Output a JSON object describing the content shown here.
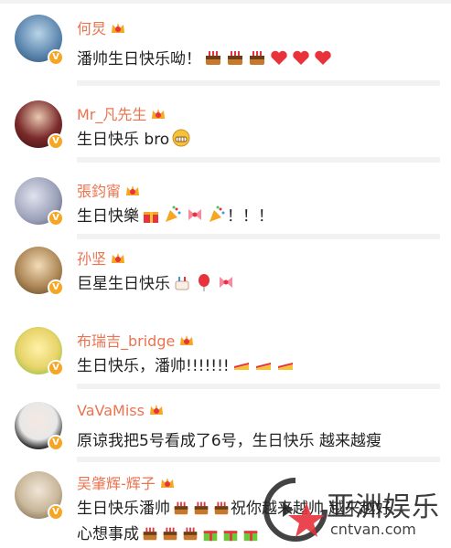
{
  "comments": [
    {
      "name": "何炅",
      "text": "潘帅生日快乐呦！",
      "avatar_color": "#6a8fb5"
    },
    {
      "name": "Mr_凡先生",
      "text": "生日快乐 bro",
      "avatar_color": "#7a2a2a"
    },
    {
      "name": "張鈞甯",
      "text": "生日快樂",
      "trail": "！！！",
      "avatar_color": "#9aa0b8"
    },
    {
      "name": "孙坚",
      "text": "巨星生日快乐",
      "avatar_color": "#b08a5a"
    },
    {
      "name": "布瑞吉_bridge",
      "text": "生日快乐，潘帅!!!!!!!",
      "avatar_color": "#e8d46a"
    },
    {
      "name": "VaVaMiss",
      "text": "原谅我把5号看成了6号，生日快乐 越来越瘦",
      "avatar_color": "#e8e8e8"
    },
    {
      "name": "吴肇辉-辉子",
      "text": "生日快乐潘帅",
      "text_tail": "祝你越来越帅 越来越好",
      "line2": "心想事成",
      "avatar_color": "#c9b79a"
    }
  ],
  "watermark": {
    "main": "亚洲娱乐",
    "sub": "cntvan.com"
  },
  "colors": {
    "name": "#eb7350",
    "badge": "#f5a623",
    "divider": "#f2f2f2",
    "heart": "#e8323c",
    "cake": "#c8782a"
  }
}
